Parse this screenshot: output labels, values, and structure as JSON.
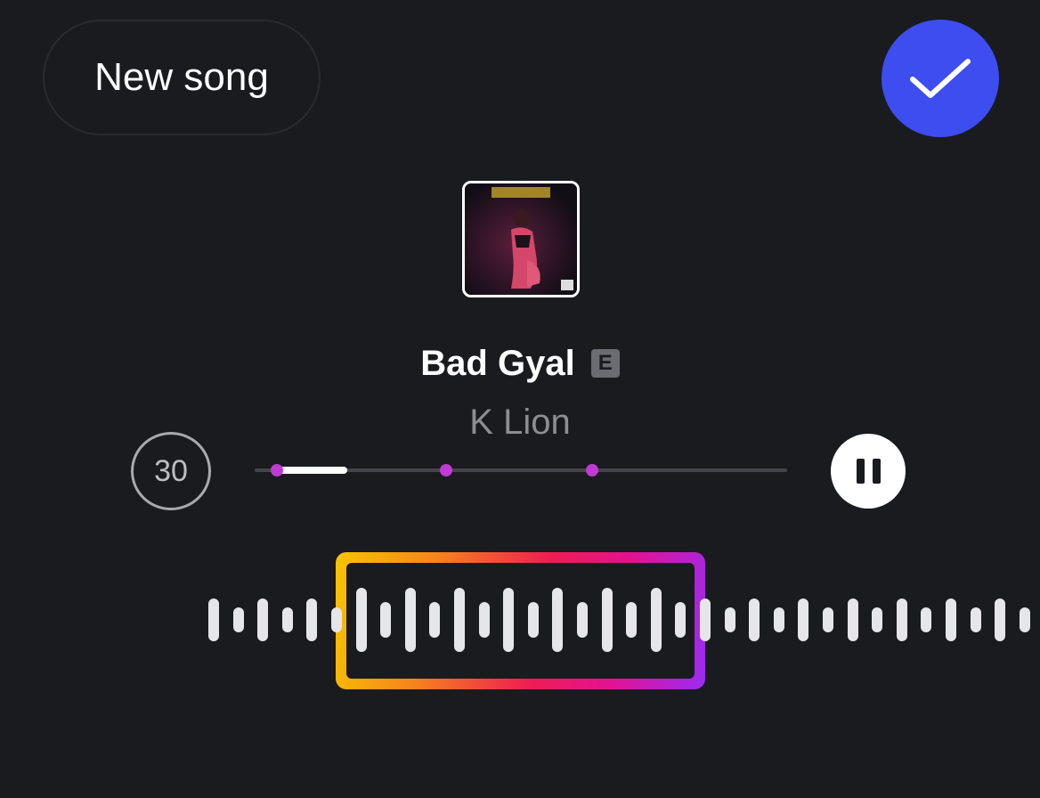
{
  "header": {
    "new_song_label": "New song",
    "done_icon": "checkmark-icon"
  },
  "track": {
    "title": "Bad Gyal",
    "explicit_badge": "E",
    "artist": "K Lion",
    "cover_icon": "album-cover-image"
  },
  "player": {
    "duration_label": "30",
    "pause_icon": "pause-icon",
    "progress": 0.13,
    "markers": [
      0.04,
      0.36,
      0.64
    ]
  },
  "colors": {
    "background": "#1a1b1f",
    "accent": "#3d4df0",
    "marker": "#c13ad6"
  }
}
